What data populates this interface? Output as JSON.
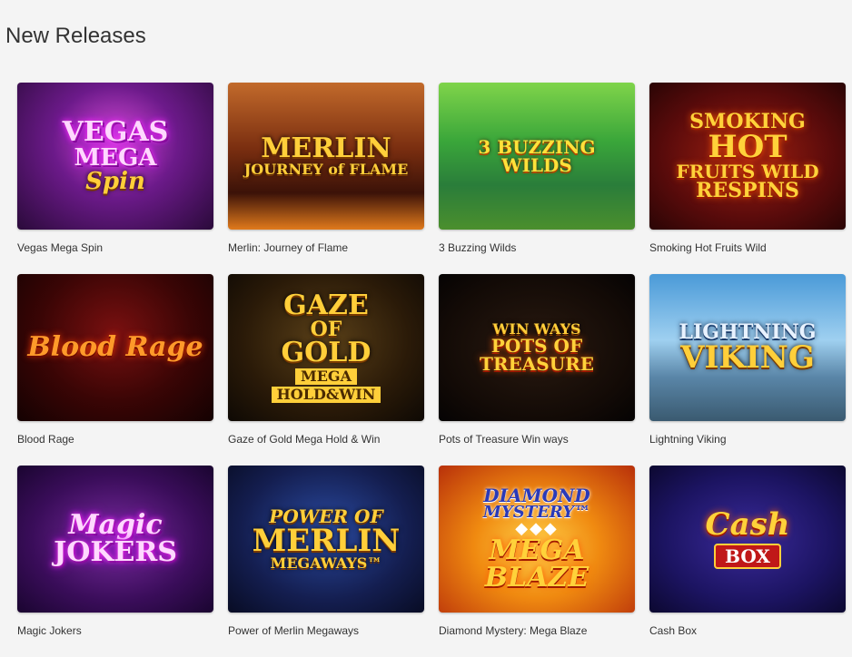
{
  "section": {
    "title": "New Releases"
  },
  "games": [
    {
      "name": "Vegas Mega Spin",
      "logo": [
        "VEGAS",
        "MEGA",
        "Spin"
      ]
    },
    {
      "name": "Merlin: Journey of Flame",
      "logo": [
        "MERLIN",
        "JOURNEY of FLAME"
      ]
    },
    {
      "name": "3 Buzzing Wilds",
      "logo": [
        "3 BUZZING WILDS"
      ]
    },
    {
      "name": "Smoking Hot Fruits Wild",
      "logo": [
        "SMOKING",
        "HOT",
        "FRUITS WILD",
        "RESPINS"
      ]
    },
    {
      "name": "Blood Rage",
      "logo": [
        "Blood Rage"
      ]
    },
    {
      "name": "Gaze of Gold Mega Hold & Win",
      "logo": [
        "GAZE",
        "OF",
        "GOLD",
        "MEGA",
        "HOLD&WIN"
      ]
    },
    {
      "name": "Pots of Treasure Win ways",
      "logo": [
        "WIN WAYS",
        "POTS OF",
        "TREASURE"
      ]
    },
    {
      "name": "Lightning Viking",
      "logo": [
        "LIGHTNING",
        "VIKING"
      ]
    },
    {
      "name": "Magic Jokers",
      "logo": [
        "Magic",
        "JOKERS"
      ]
    },
    {
      "name": "Power of Merlin Megaways",
      "logo": [
        "POWER OF",
        "MERLIN",
        "MEGAWAYS™"
      ]
    },
    {
      "name": "Diamond Mystery: Mega Blaze",
      "logo": [
        "DIAMOND",
        "MYSTERY™",
        "MEGA",
        "BLAZE"
      ]
    },
    {
      "name": "Cash Box",
      "logo": [
        "Cash",
        "BOX"
      ]
    }
  ]
}
